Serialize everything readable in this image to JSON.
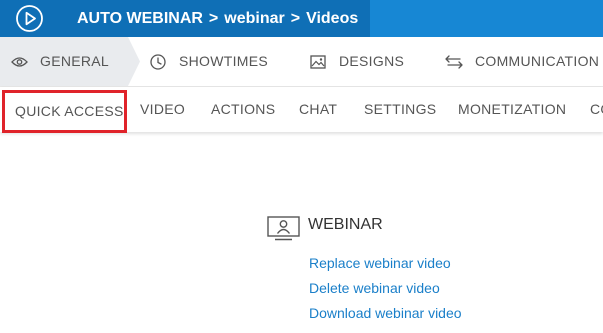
{
  "header": {
    "breadcrumb": [
      "AUTO WEBINAR",
      "webinar",
      "Videos"
    ],
    "separator": ">",
    "logo_icon": "play-circle-icon",
    "colors": {
      "bar": "#1787d4",
      "dark": "#0f6fb6"
    }
  },
  "main_tabs": [
    {
      "label": "GENERAL",
      "icon": "eye-icon",
      "active": true
    },
    {
      "label": "SHOWTIMES",
      "icon": "clock-icon"
    },
    {
      "label": "DESIGNS",
      "icon": "image-icon"
    },
    {
      "label": "COMMUNICATION",
      "icon": "exchange-arrows-icon"
    }
  ],
  "sub_tabs": [
    {
      "label": "QUICK ACCESS",
      "highlighted": true
    },
    {
      "label": "VIDEO"
    },
    {
      "label": "ACTIONS"
    },
    {
      "label": "CHAT"
    },
    {
      "label": "SETTINGS"
    },
    {
      "label": "MONETIZATION"
    },
    {
      "label": "CO"
    }
  ],
  "webinar_section": {
    "title": "WEBINAR",
    "icon": "presenter-screen-icon",
    "links": [
      "Replace webinar video",
      "Delete webinar video",
      "Download webinar video"
    ]
  },
  "highlight_color": "#e0232a",
  "link_color": "#1a7fc9"
}
